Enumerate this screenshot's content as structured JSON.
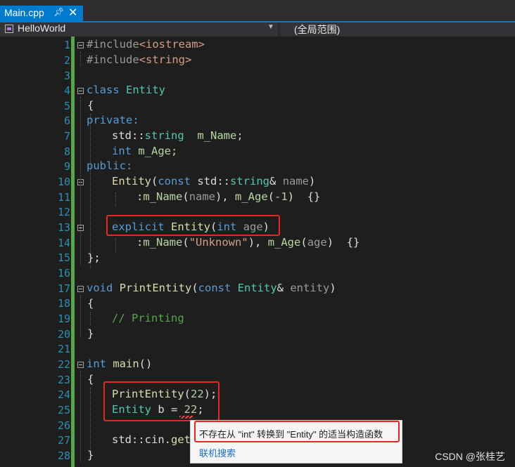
{
  "tab": {
    "title": "Main.cpp",
    "pin_icon": "pin-icon",
    "close_icon": "close-icon"
  },
  "navbar": {
    "project": "HelloWorld",
    "scope": "(全局范围)"
  },
  "line_numbers": [
    "1",
    "2",
    "3",
    "4",
    "5",
    "6",
    "7",
    "8",
    "9",
    "10",
    "11",
    "12",
    "13",
    "14",
    "15",
    "16",
    "17",
    "18",
    "19",
    "20",
    "21",
    "22",
    "23",
    "24",
    "25",
    "26",
    "27",
    "28"
  ],
  "code": {
    "l1_a": "#include",
    "l1_b": "<iostream>",
    "l2_a": "#include",
    "l2_b": "<string>",
    "l4_a": "class ",
    "l4_b": "Entity",
    "l5": "{",
    "l6": "private:",
    "l7_a": "std",
    "l7_b": "::",
    "l7_c": "string",
    "l7_d": "  m_Name;",
    "l8_a": "int ",
    "l8_b": "m_Age;",
    "l9": "public:",
    "l10_a": "Entity",
    "l10_b": "(",
    "l10_c": "const ",
    "l10_d": "std::",
    "l10_e": "string",
    "l10_f": "& ",
    "l10_g": "name",
    ")": ")",
    "l11_a": ":",
    "l11_b": "m_Name",
    "l11_c": "(",
    "l11_d": "name",
    "l11_e": "), ",
    "l11_f": "m_Age",
    "l11_g": "(",
    "l11_h": "-1",
    "l11_i": ")  {}",
    "l13_a": "explicit ",
    "l13_b": "Entity",
    "l13_c": "(",
    "l13_d": "int ",
    "l13_e": "age",
    "l14_a": ":",
    "l14_b": "m_Name",
    "l14_c": "(",
    "l14_d": "\"Unknown\"",
    "l14_e": "), ",
    "l14_f": "m_Age",
    "l14_g": "(",
    "l14_h": "age",
    "l14_i": ")  {}",
    "l15": "};",
    "l17_a": "void ",
    "l17_b": "PrintEntity",
    "l17_c": "(",
    "l17_d": "const ",
    "l17_e": "Entity",
    "l17_f": "& ",
    "l17_g": "entity",
    "l18": "{",
    "l19": "// Printing",
    "l20": "}",
    "l22_a": "int ",
    "l22_b": "main",
    "l22_c": "()",
    "l23": "{",
    "l24_a": "PrintEntity",
    "l24_b": "(",
    "l24_c": "22",
    "l24_d": ");",
    "l25_a": "Entity ",
    "l25_b": "b = ",
    "l25_c": "22",
    ";": ";",
    "l27_a": "std",
    "l27_b": "::",
    "l27_c": "cin",
    "l27_d": ".",
    "l27_e": "get",
    "l28": "}"
  },
  "tooltip": {
    "message": "不存在从 \"int\" 转换到 \"Entity\" 的适当构造函数",
    "link": "联机搜索"
  },
  "watermark": "CSDN @张桂艺",
  "colors": {
    "tab": "#007acc",
    "highlight_box": "#e8271f",
    "change_bar": "#57a64a"
  }
}
